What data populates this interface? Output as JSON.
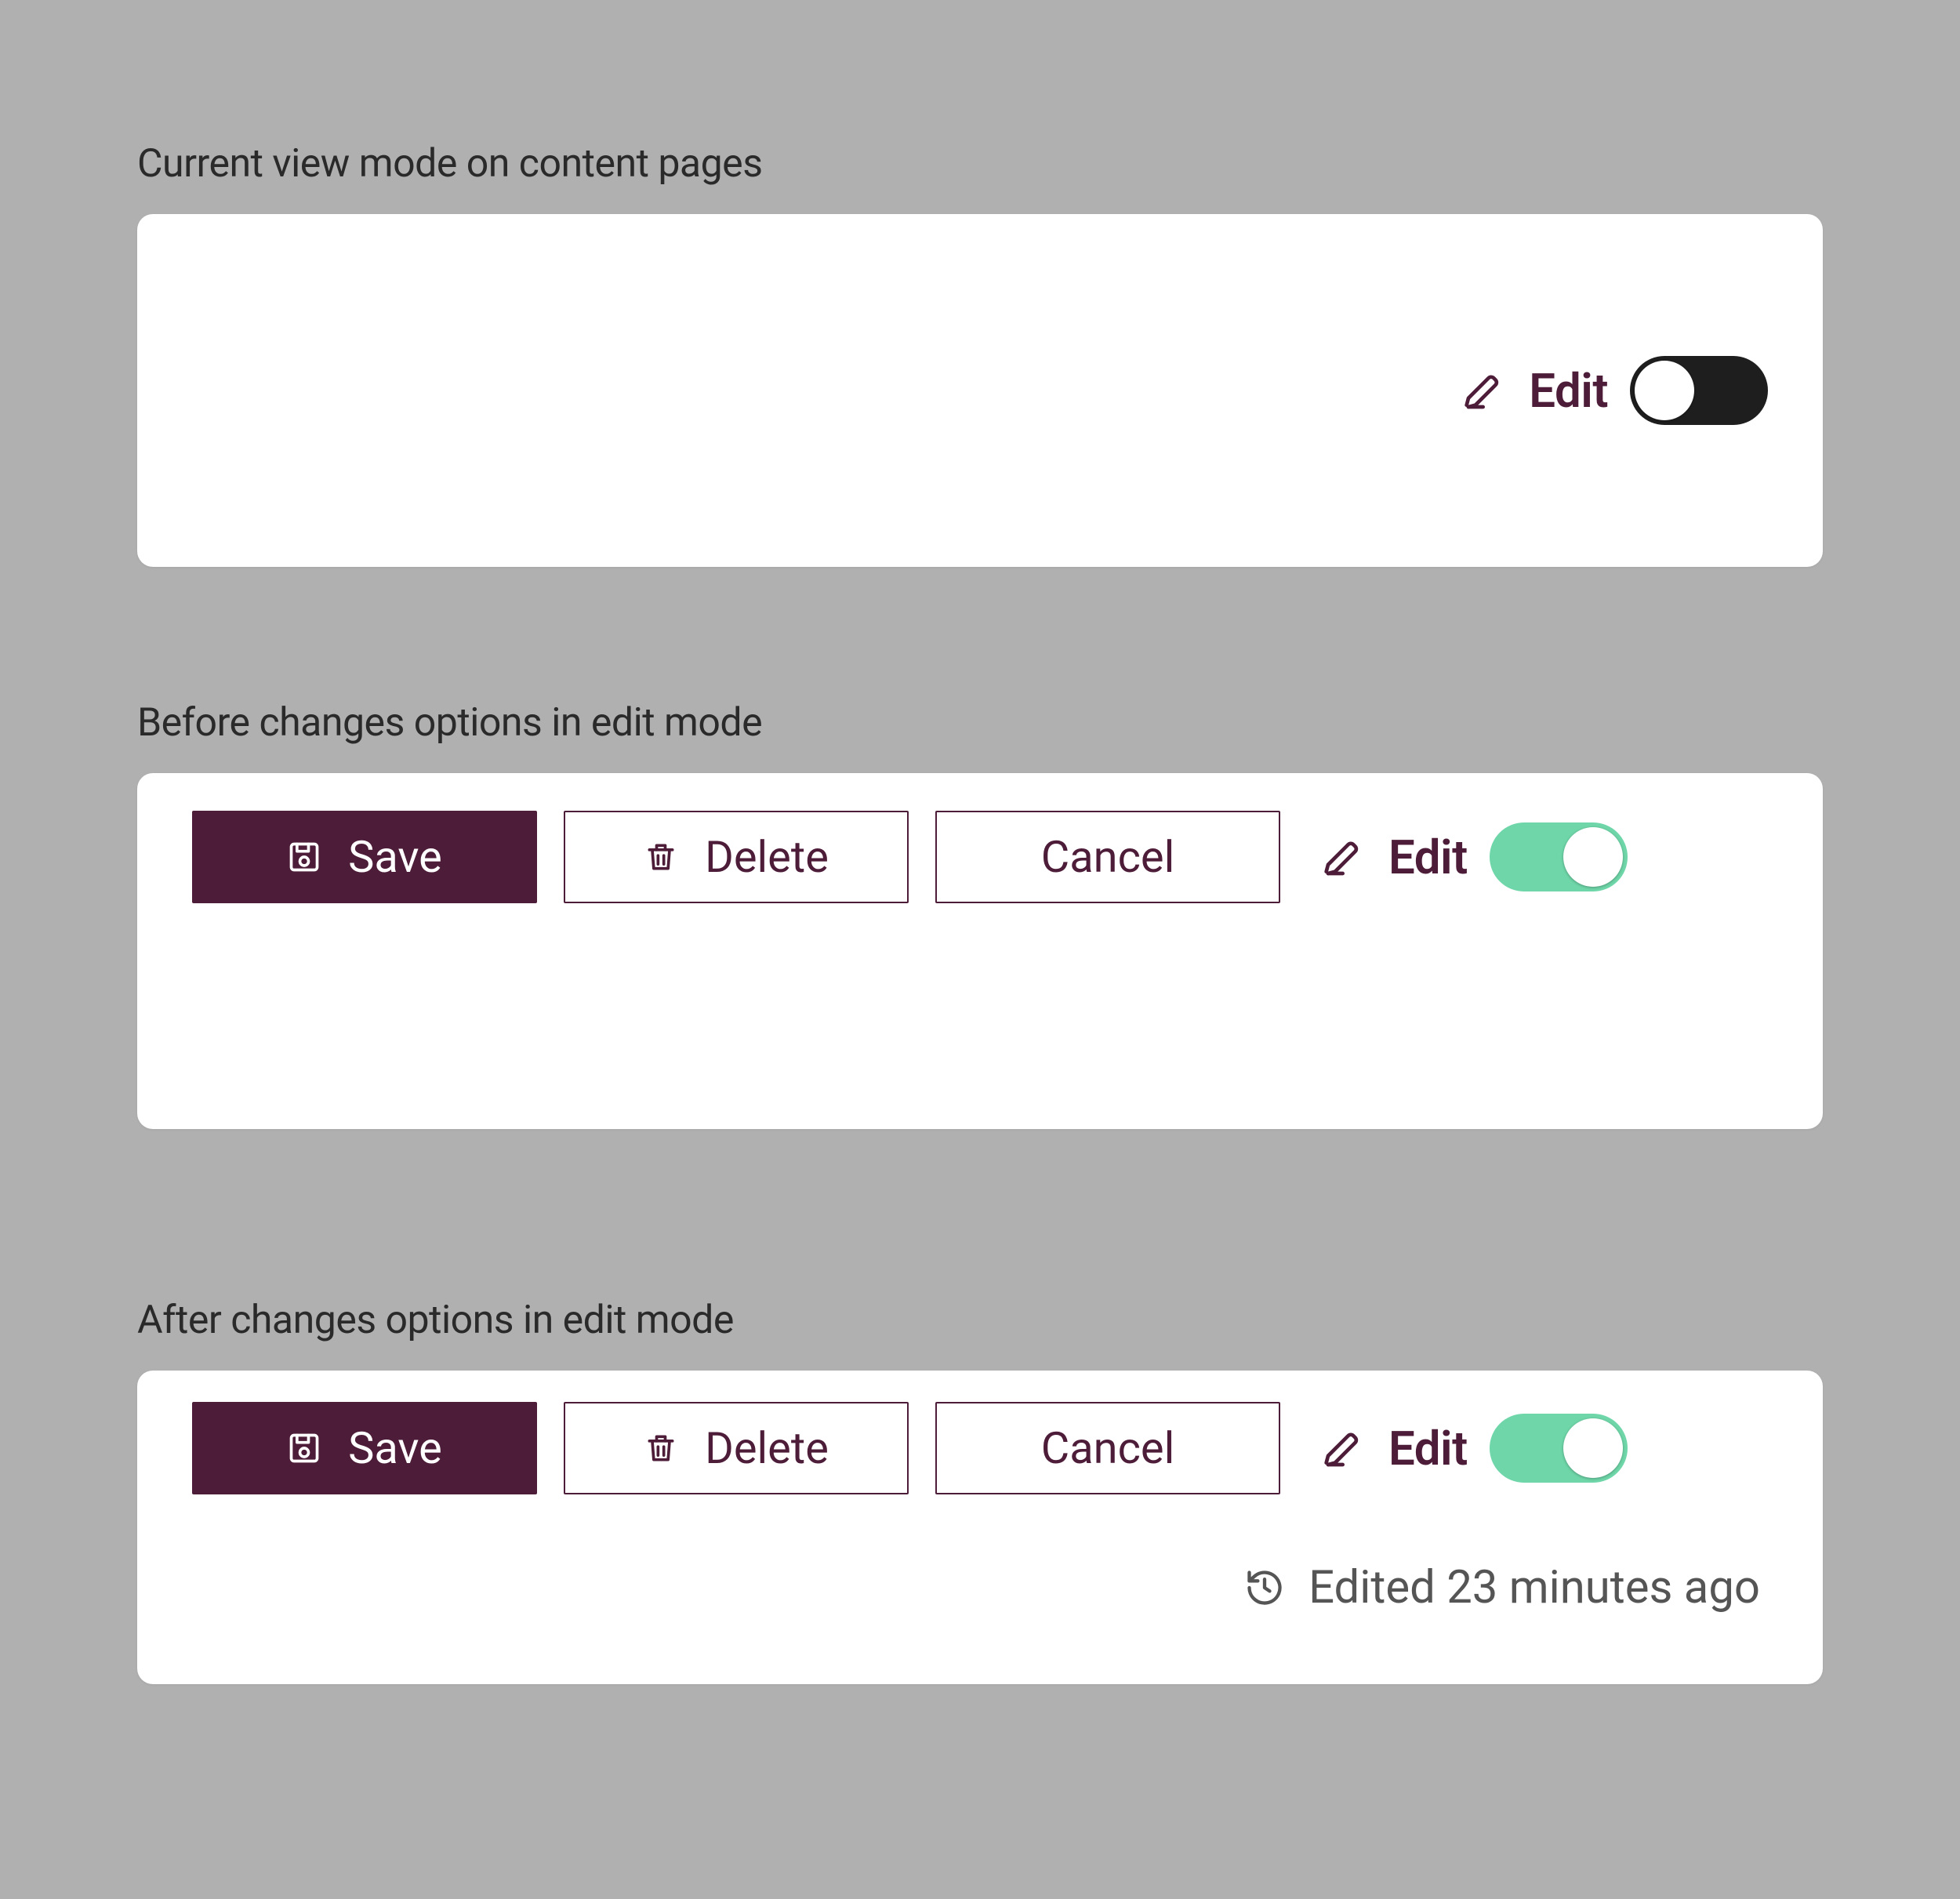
{
  "sections": {
    "viewmode": {
      "label": "Current view mode on content pages"
    },
    "before": {
      "label": "Before changes options in edit mode"
    },
    "after": {
      "label": "After changes options in edit mode"
    }
  },
  "buttons": {
    "save": "Save",
    "delete": "Delete",
    "cancel": "Cancel",
    "edit": "Edit"
  },
  "status": {
    "edited": "Edited 23 minutes ago"
  },
  "colors": {
    "accent": "#4d1c38",
    "toggle_on": "#6ed6a8",
    "toggle_off": "#1e1e1e"
  }
}
